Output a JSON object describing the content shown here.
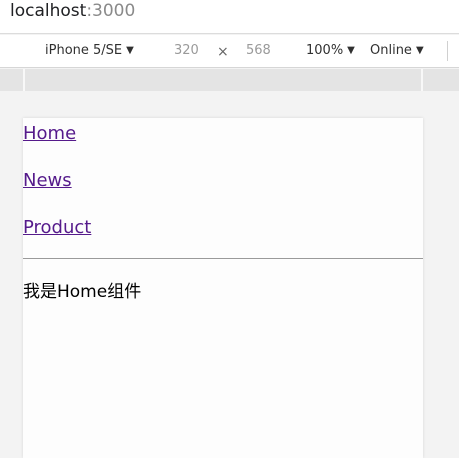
{
  "browser": {
    "url_host": "localhost",
    "url_port": ":3000"
  },
  "device_toolbar": {
    "device": "iPhone 5/SE",
    "width": "320",
    "times": "×",
    "height": "568",
    "zoom": "100%",
    "throttle": "Online"
  },
  "page": {
    "nav": [
      {
        "label": "Home"
      },
      {
        "label": "News"
      },
      {
        "label": "Product"
      }
    ],
    "component_text": "我是Home组件",
    "colors": {
      "link": "#551a8b",
      "text": "#000000"
    }
  }
}
